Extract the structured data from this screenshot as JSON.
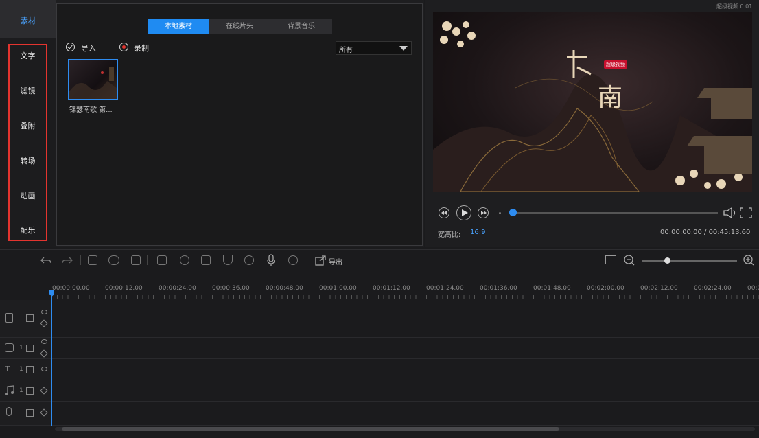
{
  "app": {
    "corner_label": "超级视频 0.01"
  },
  "sidebar": {
    "top_label": "素材",
    "items": [
      {
        "label": "文字"
      },
      {
        "label": "滤镜"
      },
      {
        "label": "叠附"
      },
      {
        "label": "转场"
      },
      {
        "label": "动画"
      },
      {
        "label": "配乐"
      }
    ]
  },
  "media": {
    "tabs": [
      {
        "label": "本地素材"
      },
      {
        "label": "在线片头"
      },
      {
        "label": "背景音乐"
      }
    ],
    "import_label": "导入",
    "record_label": "录制",
    "filter": {
      "selected": "所有"
    },
    "clips": [
      {
        "caption": "锦瑟南歌 第..."
      }
    ]
  },
  "preview": {
    "badge": "超级视频",
    "title_char": "南",
    "aspect_label": "宽高比:",
    "aspect_value": "16:9",
    "time_current": "00:00:00.00",
    "time_total": "00:45:13.60",
    "playback_progress": 0.0
  },
  "toolbar": {
    "export_label": "导出",
    "zoom_level": 0.15
  },
  "timeline": {
    "ticks": [
      "00:00:00.00",
      "00:00:12.00",
      "00:00:24.00",
      "00:00:36.00",
      "00:00:48.00",
      "00:01:00.00",
      "00:01:12.00",
      "00:01:24.00",
      "00:01:36.00",
      "00:01:48.00",
      "00:02:00.00",
      "00:02:12.00",
      "00:02:24.00",
      "00:0"
    ],
    "tracks": [
      {
        "type": "video-icon",
        "index": ""
      },
      {
        "type": "overlay-icon",
        "index": "1"
      },
      {
        "type": "text-icon",
        "index": "1"
      },
      {
        "type": "music-icon",
        "index": "1"
      },
      {
        "type": "voice-icon",
        "index": ""
      }
    ]
  },
  "colors": {
    "accent": "#1f8bf2",
    "highlight_frame": "#e3342f",
    "background": "#1b1b1d"
  }
}
